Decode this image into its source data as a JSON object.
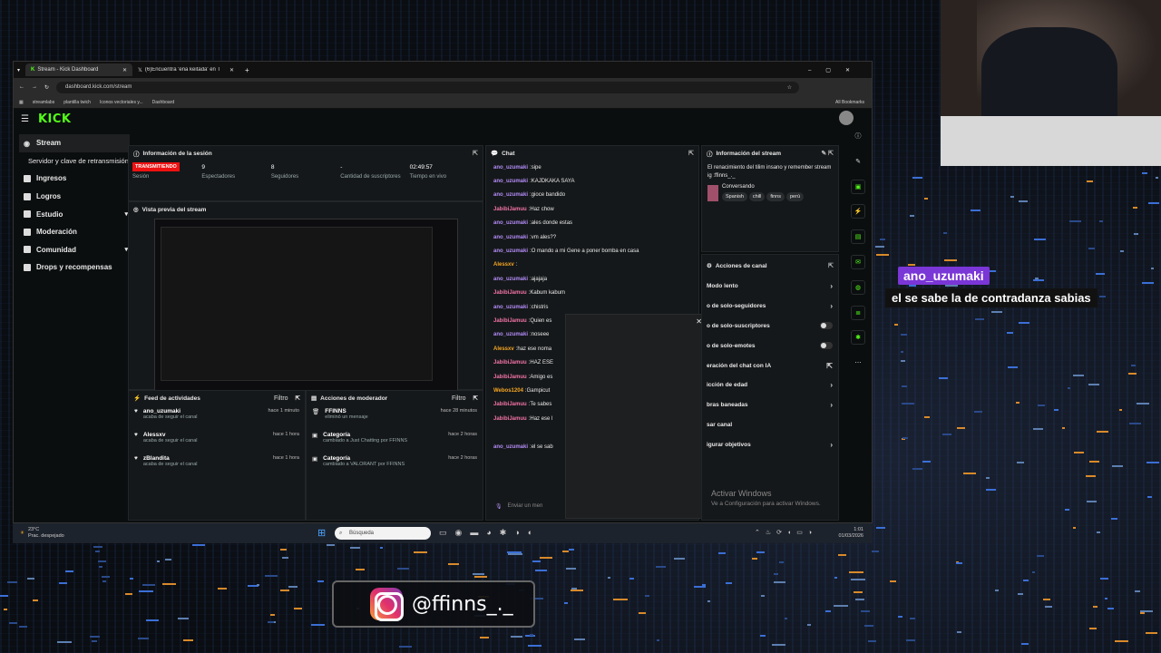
{
  "browser": {
    "tabs": [
      {
        "label": "Stream - Kick Dashboard"
      },
      {
        "label": "(6)Encuentra 'eña keitada' en T"
      }
    ],
    "url": "dashboard.kick.com/stream",
    "bookmarks": [
      "streamlabs",
      "plantilla twich",
      "Iconos vectoriales y...",
      "Dashboard"
    ],
    "all_bookmarks": "All Bookmarks"
  },
  "kick": {
    "logo": "KICK",
    "sidebar": [
      {
        "label": "Stream"
      },
      {
        "label": "Servidor y clave de retransmisión"
      },
      {
        "label": "Ingresos"
      },
      {
        "label": "Logros"
      },
      {
        "label": "Estudio"
      },
      {
        "label": "Moderación"
      },
      {
        "label": "Comunidad"
      },
      {
        "label": "Drops y recompensas"
      }
    ],
    "session": {
      "title": "Información de la sesión",
      "status": "TRANSMITIENDO",
      "status_label": "Sesión",
      "viewers": "9",
      "viewers_label": "Espectadores",
      "followers": "8",
      "followers_label": "Seguidores",
      "subs": "-",
      "subs_label": "Cantidad de suscriptores",
      "time": "02:49:57",
      "time_label": "Tiempo en vivo"
    },
    "preview": {
      "title": "Vista previa del stream"
    },
    "feed": {
      "title": "Feed de actividades",
      "filter": "Filtro",
      "rows": [
        {
          "who": "ano_uzumaki",
          "what": "acaba de seguir el canal",
          "when": "hace 1 minuto"
        },
        {
          "who": "Alessxv",
          "what": "acaba de seguir el canal",
          "when": "hace 1 hora"
        },
        {
          "who": "zBlandita",
          "what": "acaba de seguir el canal",
          "when": "hace 1 hora"
        }
      ]
    },
    "mod": {
      "title": "Acciones de moderador",
      "filter": "Filtro",
      "rows": [
        {
          "who": "FFINNS",
          "what": "eliminó un mensaje",
          "when": "hace 28 minutos"
        },
        {
          "who": "Categoría",
          "what": "cambiado a Just Chatting por FFINNS",
          "when": "hace 2 horas"
        },
        {
          "who": "Categoría",
          "what": "cambiado a VALORANT por FFINNS",
          "when": "hace 2 horas"
        }
      ]
    },
    "chat": {
      "title": "Chat",
      "messages": [
        {
          "u": "ano_uzumaki",
          "c": "#b38cf7",
          "m": "sipe"
        },
        {
          "u": "ano_uzumaki",
          "c": "#b38cf7",
          "m": "KAJDKAKA SAYA"
        },
        {
          "u": "ano_uzumaki",
          "c": "#b38cf7",
          "m": "gioce bandido"
        },
        {
          "u": "JabibiJamuu",
          "c": "#f274a8",
          "m": "Haz chow"
        },
        {
          "u": "ano_uzumaki",
          "c": "#b38cf7",
          "m": "ales donde estas"
        },
        {
          "u": "ano_uzumaki",
          "c": "#b38cf7",
          "m": "vm ales??"
        },
        {
          "u": "ano_uzumaki",
          "c": "#b38cf7",
          "m": "O mando a mi Gene a poner bomba en casa"
        },
        {
          "u": "Alessxv",
          "c": "#f5a623",
          "m": ""
        },
        {
          "u": "ano_uzumaki",
          "c": "#b38cf7",
          "m": "ajajaja"
        },
        {
          "u": "JabibiJamuu",
          "c": "#f274a8",
          "m": "Kabum kabum"
        },
        {
          "u": "ano_uzumaki",
          "c": "#b38cf7",
          "m": "chistris"
        },
        {
          "u": "JabibiJamuu",
          "c": "#f274a8",
          "m": "Quien es"
        },
        {
          "u": "ano_uzumaki",
          "c": "#b38cf7",
          "m": "noseee"
        },
        {
          "u": "Alessxv",
          "c": "#f5a623",
          "m": "haz ese noma"
        },
        {
          "u": "JabibiJamuu",
          "c": "#f274a8",
          "m": "HAZ ESE"
        },
        {
          "u": "JabibiJamuu",
          "c": "#f274a8",
          "m": "Amigo es"
        },
        {
          "u": "Webos1204",
          "c": "#f5a623",
          "m": "Gampicut"
        },
        {
          "u": "JabibiJamuu",
          "c": "#f274a8",
          "m": "Te sabes"
        },
        {
          "u": "JabibiJamuu",
          "c": "#f274a8",
          "m": "Haz ese l"
        },
        {
          "u": "",
          "c": "#fff",
          "m": ""
        },
        {
          "u": "ano_uzumaki",
          "c": "#b38cf7",
          "m": "el se sab"
        }
      ],
      "input_placeholder": "Enviar un men"
    },
    "stream_info": {
      "title": "Información del stream",
      "stream_title": "El renacimiento del tilim insano y remember stream ig :ffinns_._",
      "category": "Conversando",
      "tags": [
        "Spanish",
        "chill",
        "finns",
        "perú"
      ]
    },
    "channel_actions": {
      "title": "Acciones de canal",
      "rows": [
        {
          "label": "Modo lento",
          "kind": "chev"
        },
        {
          "label": "o de solo-seguidores",
          "kind": "chev"
        },
        {
          "label": "o de solo-suscriptores",
          "kind": "toggle"
        },
        {
          "label": "o de solo-emotes",
          "kind": "toggle"
        },
        {
          "label": "eración del chat con IA",
          "kind": "ext"
        },
        {
          "label": "icción de edad",
          "kind": "chev"
        },
        {
          "label": "bras baneadas",
          "kind": "chev"
        },
        {
          "label": "sar canal",
          "kind": "none"
        },
        {
          "label": "igurar objetivos",
          "kind": "chev"
        }
      ]
    },
    "activate_windows": {
      "line1": "Activar Windows",
      "line2": "Ve a Configuración para activar Windows."
    }
  },
  "taskbar": {
    "weather_temp": "23°C",
    "weather_desc": "Prac. despejado",
    "search_placeholder": "Búsqueda",
    "time": "1:01",
    "date": "01/03/2026"
  },
  "overlay": {
    "chat_name": "ano_uzumaki",
    "chat_msg": "el se sabe la de contradanza sabias",
    "instagram": "@ffinns_._"
  }
}
